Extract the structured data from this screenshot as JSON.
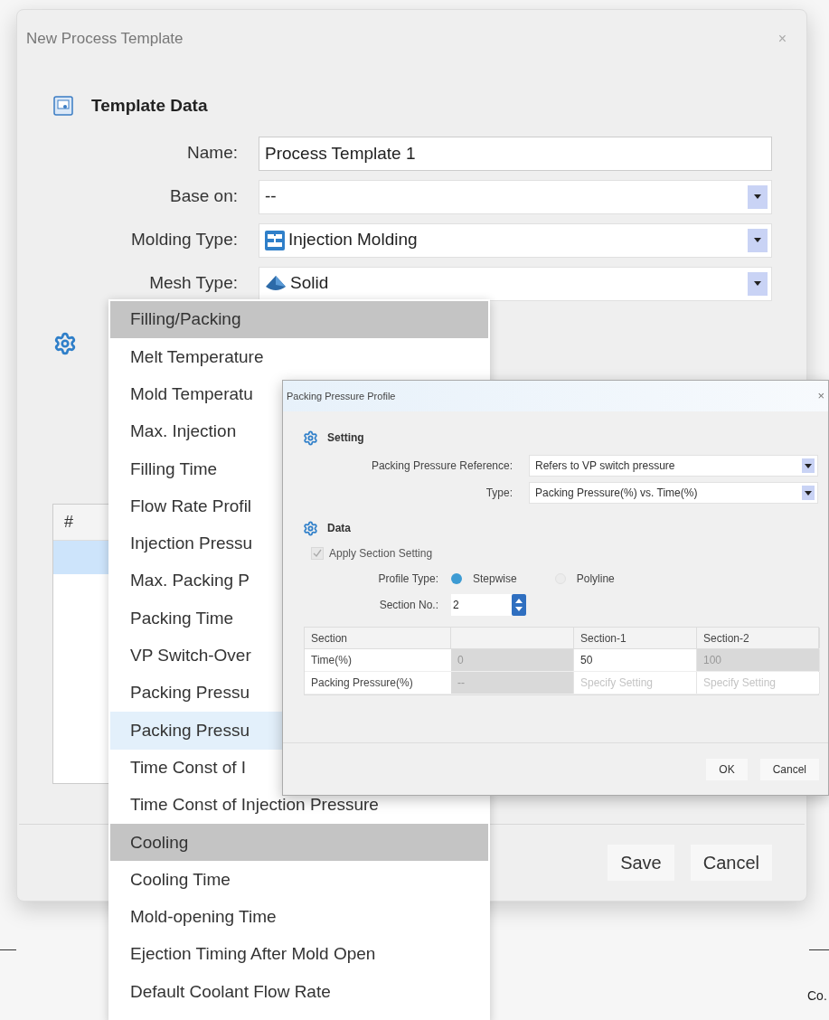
{
  "dialog": {
    "title": "New Process Template",
    "close": "×",
    "template_data": {
      "heading": "Template Data",
      "fields": [
        {
          "label": "Name:",
          "value": "Process Template 1",
          "kind": "text"
        },
        {
          "label": "Base on:",
          "value": "--",
          "kind": "select"
        },
        {
          "label": "Molding Type:",
          "value": "Injection Molding",
          "kind": "select"
        },
        {
          "label": "Mesh Type:",
          "value": "Solid",
          "kind": "select"
        }
      ]
    },
    "table": {
      "columns": [
        "#"
      ],
      "rows": [
        {
          "selected": true
        }
      ]
    },
    "buttons": [
      "Save",
      "Cancel"
    ]
  },
  "menu": {
    "items": [
      {
        "label": "Filling/Packing",
        "kind": "group",
        "selected": false
      },
      {
        "label": "Melt Temperature",
        "kind": "item",
        "selected": false
      },
      {
        "label": "Mold Temperatu",
        "kind": "item",
        "selected": false
      },
      {
        "label": "Max. Injection",
        "kind": "item",
        "selected": false
      },
      {
        "label": "Filling Time",
        "kind": "item",
        "selected": false
      },
      {
        "label": "Flow Rate Profil",
        "kind": "item",
        "selected": false
      },
      {
        "label": "Injection Pressu",
        "kind": "item",
        "selected": false
      },
      {
        "label": "Max. Packing P",
        "kind": "item",
        "selected": false
      },
      {
        "label": "Packing Time",
        "kind": "item",
        "selected": false
      },
      {
        "label": "VP Switch-Over",
        "kind": "item",
        "selected": false
      },
      {
        "label": "Packing Pressu",
        "kind": "item",
        "selected": false
      },
      {
        "label": "Packing Pressu",
        "kind": "item",
        "selected": true
      },
      {
        "label": "Time Const of I",
        "kind": "item",
        "selected": false
      },
      {
        "label": "Time Const of Injection Pressure",
        "kind": "item",
        "selected": false
      },
      {
        "label": "Cooling",
        "kind": "group",
        "selected": false
      },
      {
        "label": "Cooling Time",
        "kind": "item",
        "selected": false
      },
      {
        "label": "Mold-opening Time",
        "kind": "item",
        "selected": false
      },
      {
        "label": "Ejection Timing After Mold Open",
        "kind": "item",
        "selected": false
      },
      {
        "label": "Default Coolant Flow Rate",
        "kind": "item",
        "selected": false
      }
    ]
  },
  "sub_dialog": {
    "title": "Packing Pressure Profile",
    "close": "×",
    "setting": {
      "heading": "Setting",
      "fields": [
        {
          "label": "Packing Pressure Reference:",
          "value": "Refers to VP switch pressure"
        },
        {
          "label": "Type:",
          "value": "Packing Pressure(%) vs. Time(%)"
        }
      ]
    },
    "data": {
      "heading": "Data",
      "apply_section": {
        "label": "Apply Section Setting",
        "checked": true,
        "disabled": true
      },
      "profile_type": {
        "label": "Profile Type:",
        "options": [
          {
            "label": "Stepwise",
            "selected": true
          },
          {
            "label": "Polyline",
            "selected": false
          }
        ]
      },
      "section_no": {
        "label": "Section No.:",
        "value": "2"
      },
      "table": {
        "columns": [
          "Section",
          "",
          "Section-1",
          "Section-2"
        ],
        "rows": [
          {
            "cells": [
              {
                "value": "Time(%)",
                "kind": "header"
              },
              {
                "value": "0",
                "disabled": true
              },
              {
                "value": "50",
                "disabled": false
              },
              {
                "value": "100",
                "disabled": true
              }
            ]
          },
          {
            "cells": [
              {
                "value": "Packing Pressure(%)",
                "kind": "header"
              },
              {
                "value": "--",
                "disabled": true
              },
              {
                "placeholder": "Specify Setting",
                "disabled": false
              },
              {
                "placeholder": "Specify Setting",
                "disabled": false
              }
            ]
          }
        ]
      }
    },
    "buttons": [
      "OK",
      "Cancel"
    ]
  },
  "background": {
    "text": "Co."
  }
}
